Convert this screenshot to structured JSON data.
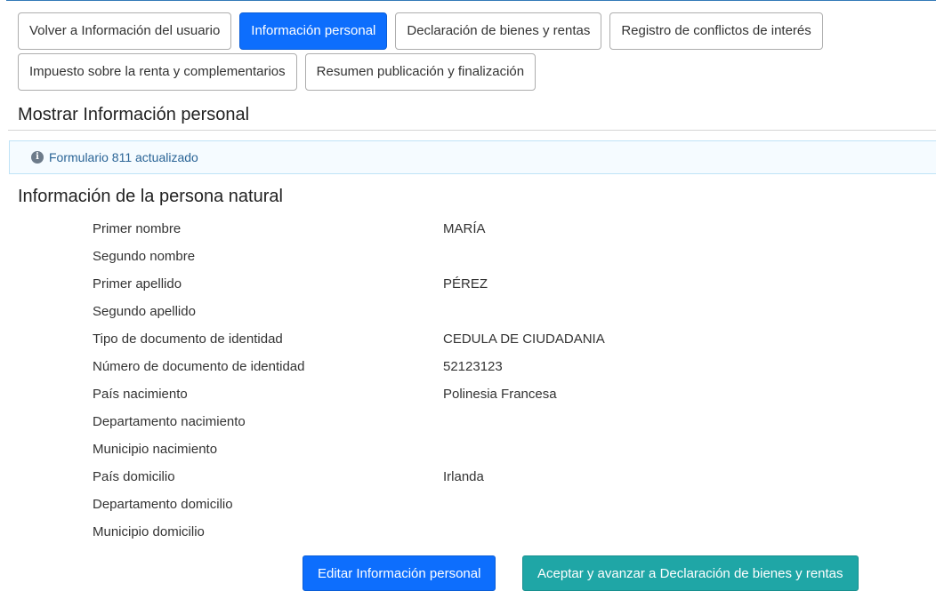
{
  "tabs": [
    {
      "label": "Volver a Información del usuario",
      "active": false
    },
    {
      "label": "Información personal",
      "active": true
    },
    {
      "label": "Declaración de bienes y rentas",
      "active": false
    },
    {
      "label": "Registro de conflictos de interés",
      "active": false
    },
    {
      "label": "Impuesto sobre la renta y complementarios",
      "active": false
    },
    {
      "label": "Resumen publicación y finalización",
      "active": false
    }
  ],
  "section_title": "Mostrar Información personal",
  "alert": {
    "icon": "info-icon",
    "text": "Formulario 811 actualizado"
  },
  "subtitle": "Información de la persona natural",
  "fields": [
    {
      "label": "Primer nombre",
      "value": "MARÍA"
    },
    {
      "label": "Segundo nombre",
      "value": ""
    },
    {
      "label": "Primer apellido",
      "value": "PÉREZ"
    },
    {
      "label": "Segundo apellido",
      "value": ""
    },
    {
      "label": "Tipo de documento de identidad",
      "value": "CEDULA DE CIUDADANIA"
    },
    {
      "label": "Número de documento de identidad",
      "value": "52123123"
    },
    {
      "label": "País nacimiento",
      "value": "Polinesia Francesa"
    },
    {
      "label": "Departamento nacimiento",
      "value": ""
    },
    {
      "label": "Municipio nacimiento",
      "value": ""
    },
    {
      "label": "País domicilio",
      "value": "Irlanda"
    },
    {
      "label": "Departamento domicilio",
      "value": ""
    },
    {
      "label": "Municipio domicilio",
      "value": ""
    }
  ],
  "buttons": {
    "edit_label": "Editar Información personal",
    "accept_label": "Aceptar y avanzar a Declaración de bienes y rentas"
  },
  "colors": {
    "primary": "#0d6efd",
    "accept": "#1fa6a6",
    "alert_text": "#2a6496",
    "alert_border": "#bfe3f7"
  }
}
